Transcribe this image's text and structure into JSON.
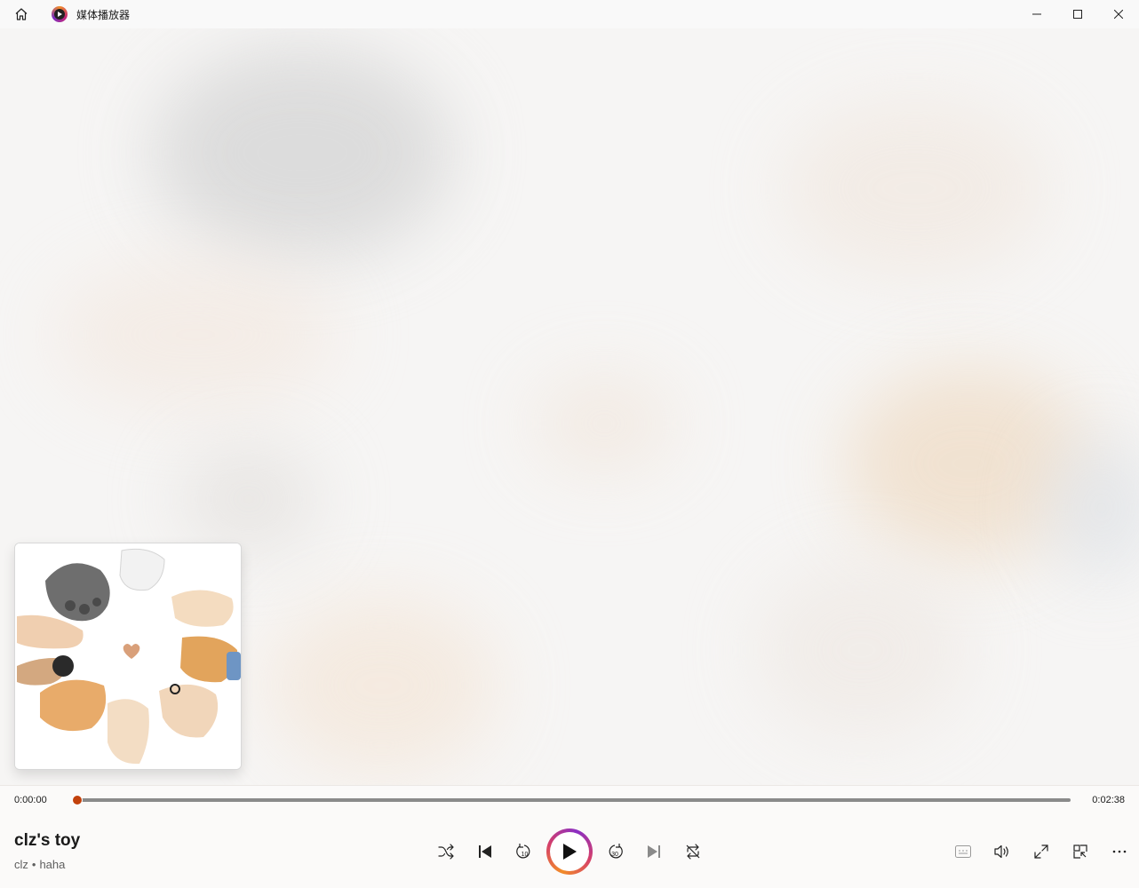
{
  "window": {
    "title": "媒体播放器",
    "icons": {
      "home": "home-icon",
      "app": "media-player-app-icon",
      "minimize": "minimize-icon",
      "maximize": "maximize-icon",
      "close": "close-icon"
    }
  },
  "now_playing": {
    "title": "clz's toy",
    "artist": "clz",
    "separator": "•",
    "album": "haha",
    "album_art": "album-art-hands-heart"
  },
  "playback": {
    "current_time": "0:00:00",
    "total_time": "0:02:38",
    "progress_fraction": 0.0,
    "accent_color": "#c2410c"
  },
  "controls": {
    "shuffle": "shuffle-icon",
    "previous": "previous-track-icon",
    "rewind": "rewind-10-icon",
    "rewind_label": "10",
    "play": "play-icon",
    "forward": "forward-30-icon",
    "forward_label": "30",
    "next": "next-track-icon",
    "repeat": "repeat-icon",
    "captions": "captions-icon",
    "volume": "volume-icon",
    "fullscreen": "fullscreen-icon",
    "mini_player": "mini-player-icon",
    "more": "more-options-icon"
  }
}
